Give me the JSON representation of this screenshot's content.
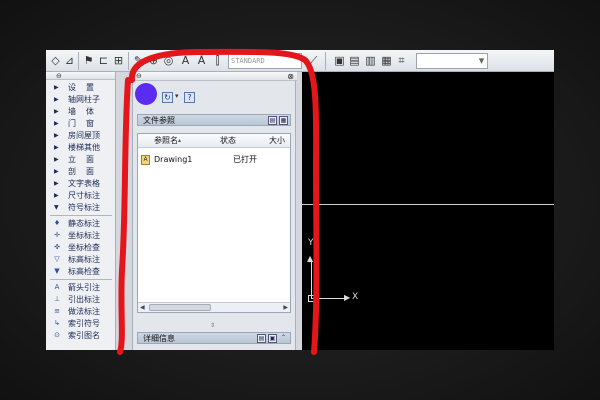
{
  "toolbar": {
    "text_style_value": "STANDARD",
    "layer_value": "",
    "icons": [
      "draw-icon",
      "eraser-icon",
      "flag-icon",
      "window-icon",
      "grid-icon",
      "pen-icon",
      "zoom-icon",
      "dimension-icon",
      "wall-icon",
      "text-style-icon",
      "layer-icon",
      "layer-prop-icon",
      "layer-state-icon",
      "layer-freeze-icon"
    ]
  },
  "tool_panel": {
    "items": [
      {
        "label": "设　置",
        "kind": "menu"
      },
      {
        "label": "轴网柱子",
        "kind": "menu"
      },
      {
        "label": "墙　体",
        "kind": "menu"
      },
      {
        "label": "门　窗",
        "kind": "menu"
      },
      {
        "label": "房间屋顶",
        "kind": "menu"
      },
      {
        "label": "楼梯其他",
        "kind": "menu"
      },
      {
        "label": "立　面",
        "kind": "menu"
      },
      {
        "label": "剖　面",
        "kind": "menu"
      },
      {
        "label": "文字表格",
        "kind": "menu"
      },
      {
        "label": "尺寸标注",
        "kind": "menu"
      },
      {
        "label": "符号标注",
        "kind": "menu-open"
      },
      {
        "label": "静态标注",
        "kind": "tool"
      },
      {
        "label": "坐标标注",
        "kind": "tool"
      },
      {
        "label": "坐标检查",
        "kind": "tool"
      },
      {
        "label": "标高标注",
        "kind": "tool"
      },
      {
        "label": "标高检查",
        "kind": "tool"
      },
      {
        "label": "箭头引注",
        "kind": "tool"
      },
      {
        "label": "引出标注",
        "kind": "tool"
      },
      {
        "label": "做法标注",
        "kind": "tool"
      },
      {
        "label": "索引符号",
        "kind": "tool"
      },
      {
        "label": "索引图名",
        "kind": "tool"
      }
    ]
  },
  "file_panel": {
    "section_title": "文件参照",
    "columns": [
      "参照名",
      "状态",
      "大小"
    ],
    "rows": [
      {
        "name": "Drawing1",
        "status": "已打开"
      }
    ],
    "details_title": "详细信息"
  },
  "canvas": {
    "ucs_x_label": "X",
    "ucs_y_label": "Y"
  },
  "colors": {
    "annotation_red": "#e3161b",
    "highlight_dot": "#5a2cf0",
    "canvas_bg": "#000000"
  }
}
